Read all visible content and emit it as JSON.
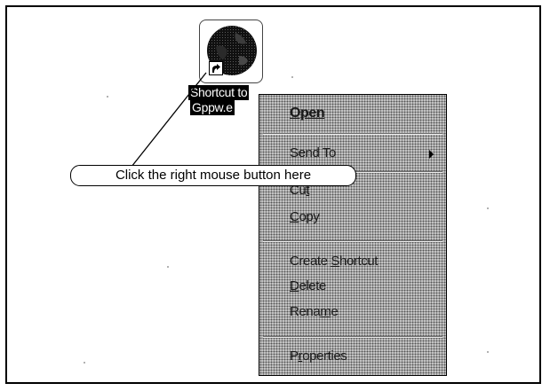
{
  "desktop_icon": {
    "label_line1": "Shortcut to",
    "label_line2": "Gppw.e",
    "shortcut_glyph": "shortcut-arrow-icon"
  },
  "context_menu": {
    "items": [
      {
        "label": "Open",
        "mnemonic": "O",
        "bold": true
      },
      {
        "label": "Send To",
        "has_submenu": true
      },
      {
        "label": "Cut",
        "mnemonic": "t"
      },
      {
        "label": "Copy",
        "mnemonic": "C"
      },
      {
        "label": "Create Shortcut",
        "mnemonic": "S"
      },
      {
        "label": "Delete",
        "mnemonic": "D"
      },
      {
        "label": "Rename",
        "mnemonic": "m"
      },
      {
        "label": "Properties",
        "mnemonic": "r"
      }
    ]
  },
  "callout": {
    "text": "Click the right mouse button here"
  },
  "colors": {
    "menu_background": "#c6c6c6",
    "label_highlight": "#000000",
    "frame_border": "#000000"
  }
}
